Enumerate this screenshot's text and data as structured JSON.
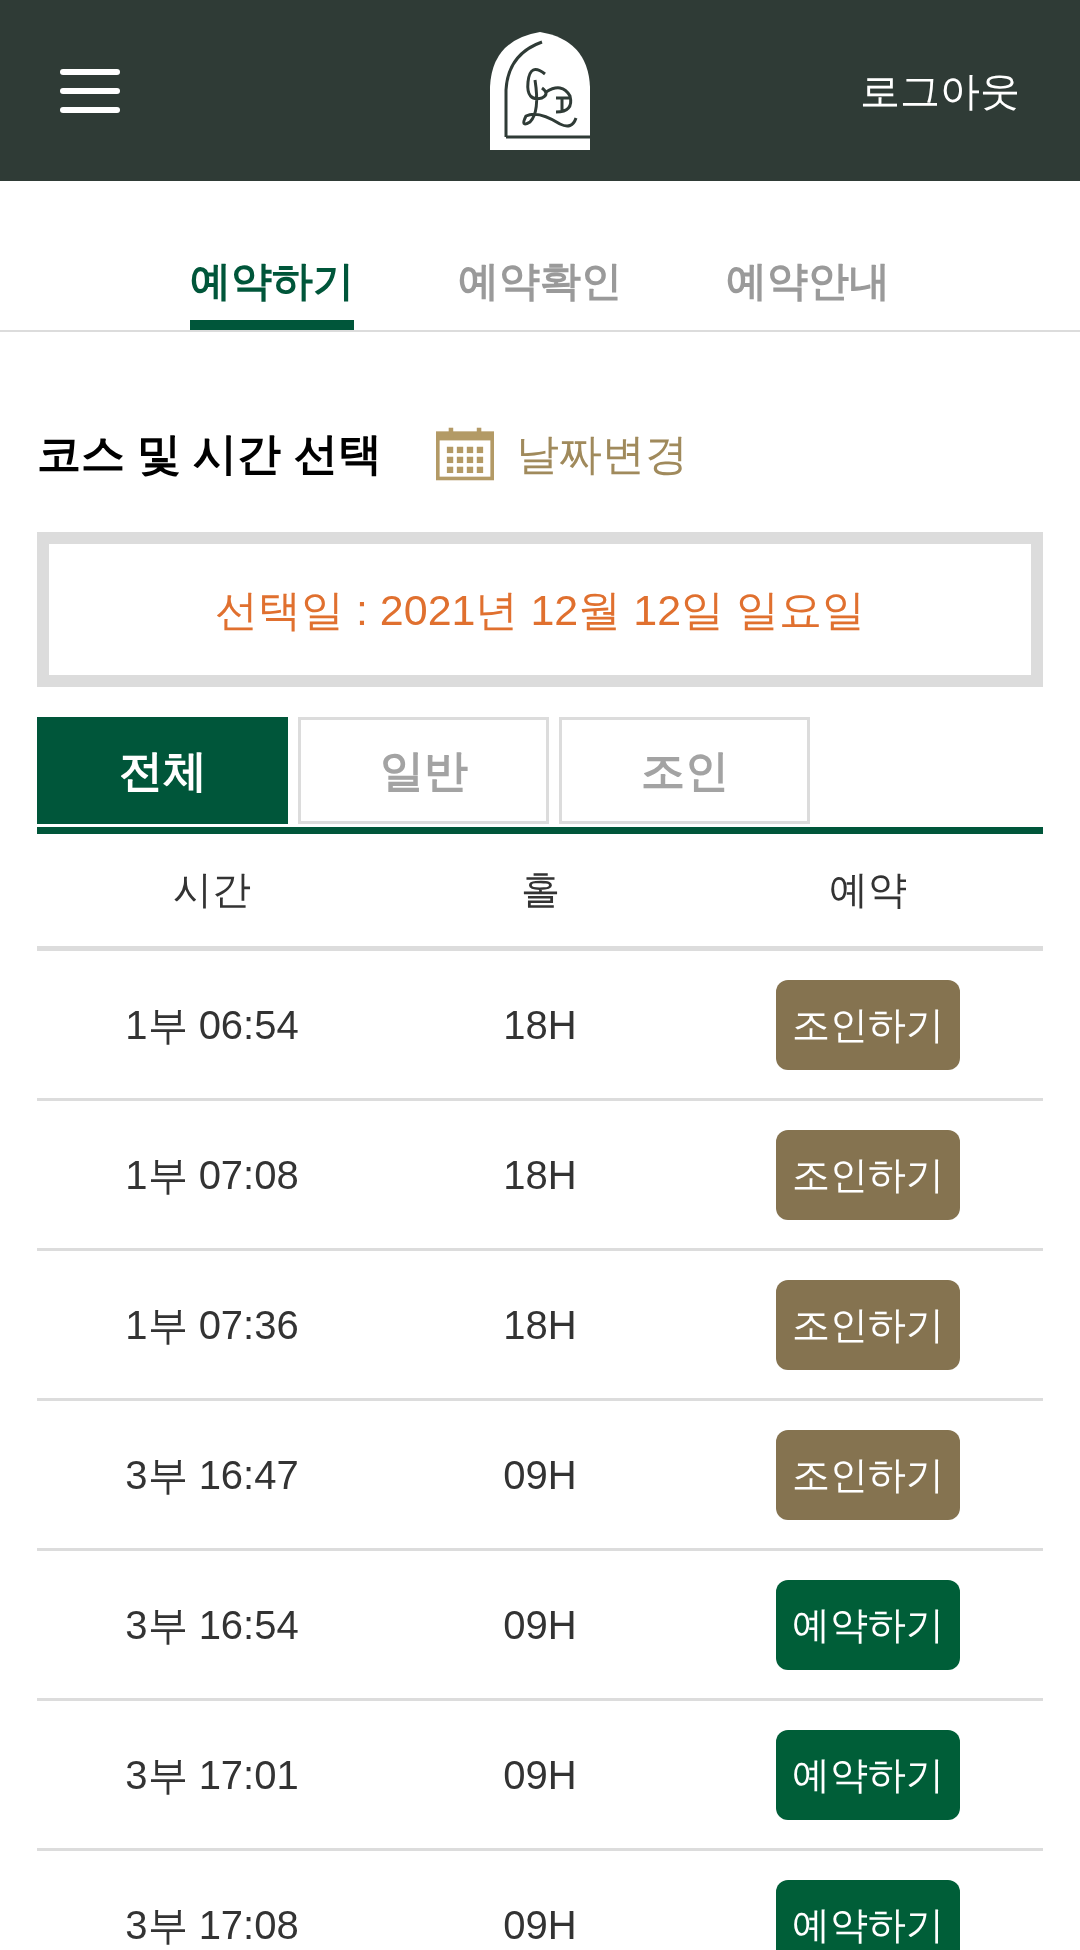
{
  "header": {
    "logout": "로그아웃"
  },
  "tabs": [
    {
      "label": "예약하기",
      "selected": true
    },
    {
      "label": "예약확인",
      "selected": false
    },
    {
      "label": "예약안내",
      "selected": false
    }
  ],
  "section": {
    "title": "코스 및 시간 선택",
    "change_date": "날짜변경"
  },
  "selected_date": "선택일 : 2021년 12월 12일 일요일",
  "filters": [
    {
      "label": "전체",
      "selected": true
    },
    {
      "label": "일반",
      "selected": false
    },
    {
      "label": "조인",
      "selected": false
    }
  ],
  "table": {
    "columns": [
      "시간",
      "홀",
      "예약"
    ],
    "rows": [
      {
        "time": "1부 06:54",
        "holes": "18H",
        "action": {
          "kind": "join",
          "label": "조인하기"
        }
      },
      {
        "time": "1부 07:08",
        "holes": "18H",
        "action": {
          "kind": "join",
          "label": "조인하기"
        }
      },
      {
        "time": "1부 07:36",
        "holes": "18H",
        "action": {
          "kind": "join",
          "label": "조인하기"
        }
      },
      {
        "time": "3부 16:47",
        "holes": "09H",
        "action": {
          "kind": "join",
          "label": "조인하기"
        }
      },
      {
        "time": "3부 16:54",
        "holes": "09H",
        "action": {
          "kind": "reserve",
          "label": "예약하기"
        }
      },
      {
        "time": "3부 17:01",
        "holes": "09H",
        "action": {
          "kind": "reserve",
          "label": "예약하기"
        }
      },
      {
        "time": "3부 17:08",
        "holes": "09H",
        "action": {
          "kind": "reserve",
          "label": "예약하기"
        }
      }
    ]
  }
}
